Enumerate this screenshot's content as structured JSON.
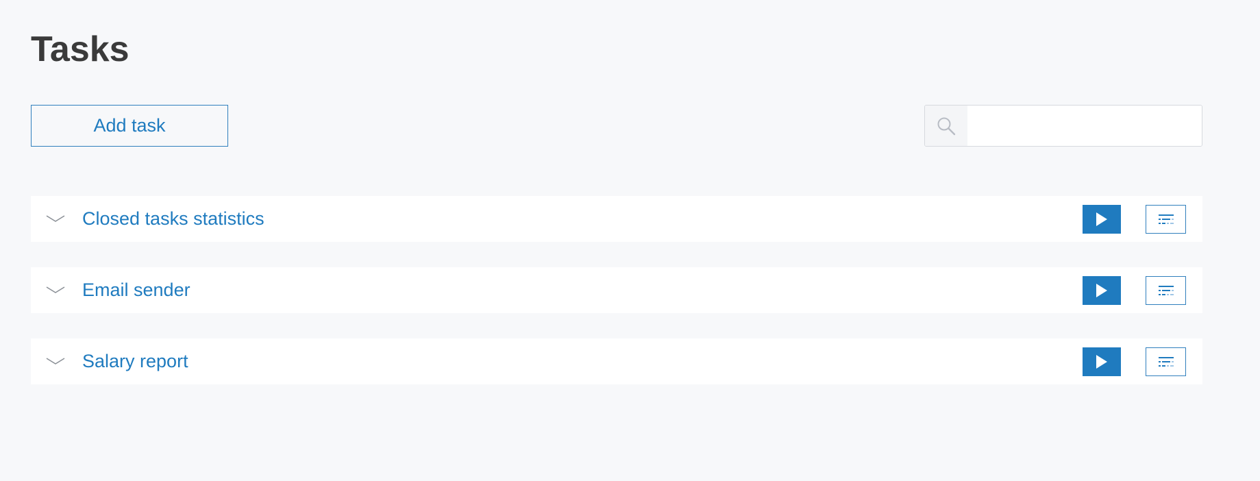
{
  "page": {
    "title": "Tasks"
  },
  "toolbar": {
    "add_label": "Add task",
    "search_icon": "search-icon",
    "search_value": "",
    "search_placeholder": ""
  },
  "tasks": [
    {
      "name": "Closed tasks statistics",
      "expand_icon": "chevron-down-icon",
      "run_icon": "play-icon",
      "config_icon": "filter-settings-icon"
    },
    {
      "name": "Email sender",
      "expand_icon": "chevron-down-icon",
      "run_icon": "play-icon",
      "config_icon": "filter-settings-icon"
    },
    {
      "name": "Salary report",
      "expand_icon": "chevron-down-icon",
      "run_icon": "play-icon",
      "config_icon": "filter-settings-icon"
    }
  ],
  "colors": {
    "accent": "#1f7bbf",
    "background": "#f7f8fa",
    "row_background": "#ffffff",
    "title_text": "#3a3a3a"
  }
}
